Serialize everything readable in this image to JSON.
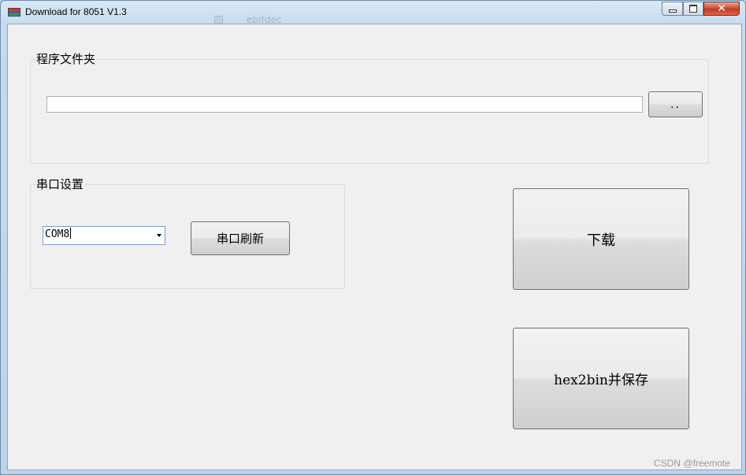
{
  "window": {
    "title": "Download for 8051 V1.3",
    "background_text": "四",
    "background_text_2": "ebitdec",
    "close_label": "✕"
  },
  "program_folder": {
    "label": "程序文件夹",
    "path_value": "",
    "browse_label": ".."
  },
  "serial": {
    "label": "串口设置",
    "port_value": "COM8",
    "refresh_label": "串口刷新"
  },
  "actions": {
    "download_label": "下载",
    "hex2bin_label": "hex2bin并保存"
  },
  "watermark": "CSDN @freemote",
  "colors": {
    "client_bg": "#f0f0f0",
    "titlebar": "#c7dbef",
    "close_button": "#c23a23"
  }
}
